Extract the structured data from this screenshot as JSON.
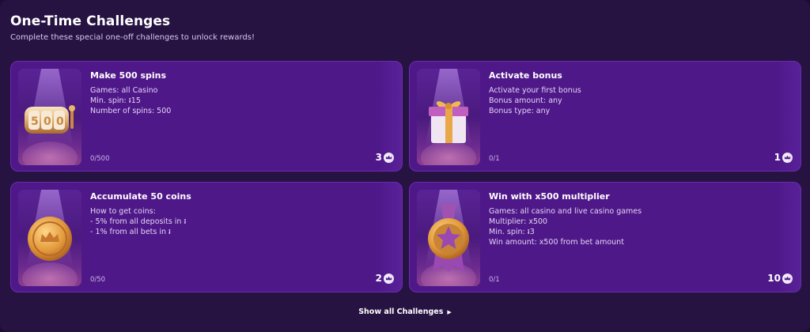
{
  "header": {
    "title": "One-Time Challenges",
    "subtitle": "Complete these special one-off challenges to unlock rewards!"
  },
  "challenges": [
    {
      "title": "Make 500 spins",
      "lines": [
        "Games: all Casino",
        "Min. spin: ៛15",
        "Number of spins: 500"
      ],
      "progress": "0/500",
      "reward": "3",
      "image": "slot-reels-icon"
    },
    {
      "title": "Activate bonus",
      "lines": [
        "Activate your first bonus",
        "Bonus amount: any",
        "Bonus type: any"
      ],
      "progress": "0/1",
      "reward": "1",
      "image": "gift-box-icon"
    },
    {
      "title": "Accumulate 50 coins",
      "lines": [
        "How to get coins:",
        "- 5% from all deposits in ៛",
        "- 1% from all bets in ៛"
      ],
      "progress": "0/50",
      "reward": "2",
      "image": "gold-coin-icon"
    },
    {
      "title": "Win with x500 multiplier",
      "lines": [
        "Games: all casino and live casino games",
        "Multiplier: x500",
        "Min. spin: ៛3",
        "Win amount: x500 from bet amount"
      ],
      "progress": "0/1",
      "reward": "10",
      "image": "star-medal-icon"
    }
  ],
  "footer": {
    "show_all_label": "Show all Challenges"
  },
  "colors": {
    "page_bg": "#261342",
    "card_bg": "#4f1889",
    "gold": "#e0a040"
  }
}
